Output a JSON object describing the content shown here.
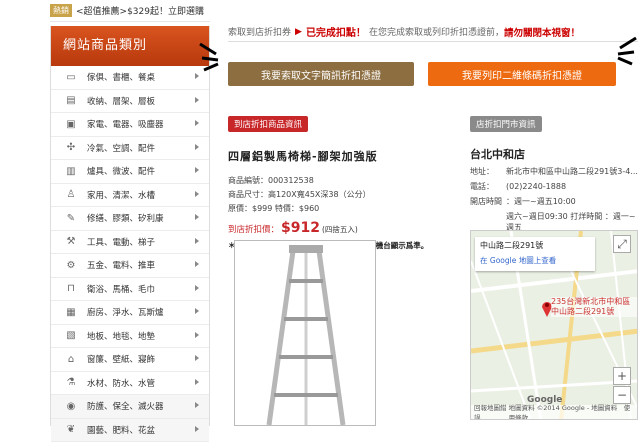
{
  "topbar": {
    "badge": "熱銷",
    "promo": "<超值推薦>$329起！立即選購"
  },
  "sidebar": {
    "title": "網站商品類別",
    "items": [
      {
        "label": "傢俱、書櫃、餐桌",
        "icon": "sofa-icon",
        "glyph": "▭"
      },
      {
        "label": "收納、層架、層板",
        "icon": "shelf-icon",
        "glyph": "▤"
      },
      {
        "label": "家電、電器、吸塵器",
        "icon": "appliance-icon",
        "glyph": "▣"
      },
      {
        "label": "冷氣、空調、配件",
        "icon": "fan-icon",
        "glyph": "✣"
      },
      {
        "label": "爐具、微波、配件",
        "icon": "stove-icon",
        "glyph": "▥"
      },
      {
        "label": "家用、清潔、水槽",
        "icon": "bottle-icon",
        "glyph": "♙"
      },
      {
        "label": "修繕、膠類、矽利康",
        "icon": "brush-icon",
        "glyph": "✎"
      },
      {
        "label": "工具、電動、梯子",
        "icon": "tool-icon",
        "glyph": "⚒"
      },
      {
        "label": "五金、電料、推車",
        "icon": "hardware-icon",
        "glyph": "⚙"
      },
      {
        "label": "衛浴、馬桶、毛巾",
        "icon": "toilet-icon",
        "glyph": "⊓"
      },
      {
        "label": "廚房、淨水、瓦斯爐",
        "icon": "kitchen-icon",
        "glyph": "▦"
      },
      {
        "label": "地板、地毯、地墊",
        "icon": "floor-icon",
        "glyph": "▧"
      },
      {
        "label": "窗簾、壁紙、寢飾",
        "icon": "curtain-icon",
        "glyph": "⌂"
      },
      {
        "label": "水材、防水、水管",
        "icon": "flask-icon",
        "glyph": "⚗"
      },
      {
        "label": "防護、保全、滅火器",
        "icon": "eye-icon",
        "glyph": "◉"
      },
      {
        "label": "園藝、肥料、花盆",
        "icon": "garden-icon",
        "glyph": "❦"
      }
    ]
  },
  "notice": {
    "step": "索取到店折扣券",
    "done": "已完成扣點！",
    "text": "在您完成索取或列印折扣憑證前，",
    "warn": "請勿關閉本視窗！"
  },
  "buttons": {
    "text_coupon": "我要索取文字簡訊折扣憑證",
    "print_coupon": "我要列印二維條碼折扣憑證"
  },
  "product": {
    "tag": "到店折扣商品資訊",
    "name": "四層鋁製馬椅梯-腳架加強版",
    "code": "商品編號：000312538",
    "size": "商品尺寸：高120X寬45X深38（公分）",
    "orig": "原價：$999 特價：$960",
    "price_label": "到店折扣價：",
    "price": "$912",
    "price_note": "(四捨五入)",
    "note": "＊當購買數量大於1時，實際付款金額依收銀機台顯示爲準。"
  },
  "store": {
    "tag": "店折扣門市資訊",
    "name": "台北中和店",
    "rows": [
      {
        "k": "地址：",
        "v": "新北市中和區中山路二段291號3-4..."
      },
      {
        "k": "電話：",
        "v": "(02)2240-1888"
      },
      {
        "k": "開店時間",
        "v": "：週一~週五10:00"
      },
      {
        "k": "",
        "v": "週六~週日09:30 打烊時間 ：週一~週五"
      },
      {
        "k": "",
        "v": "22:30"
      }
    ]
  },
  "map": {
    "card_title": "中山路二段291號",
    "card_link": "在 Google 地圖上查看",
    "pin_label": "235台灣新北市中和區中山路二段291號",
    "logo": "Google",
    "footer": "地圖資料 ©2014 Google - 地圖資料　使用條款",
    "report": "回報地圖錯誤"
  }
}
